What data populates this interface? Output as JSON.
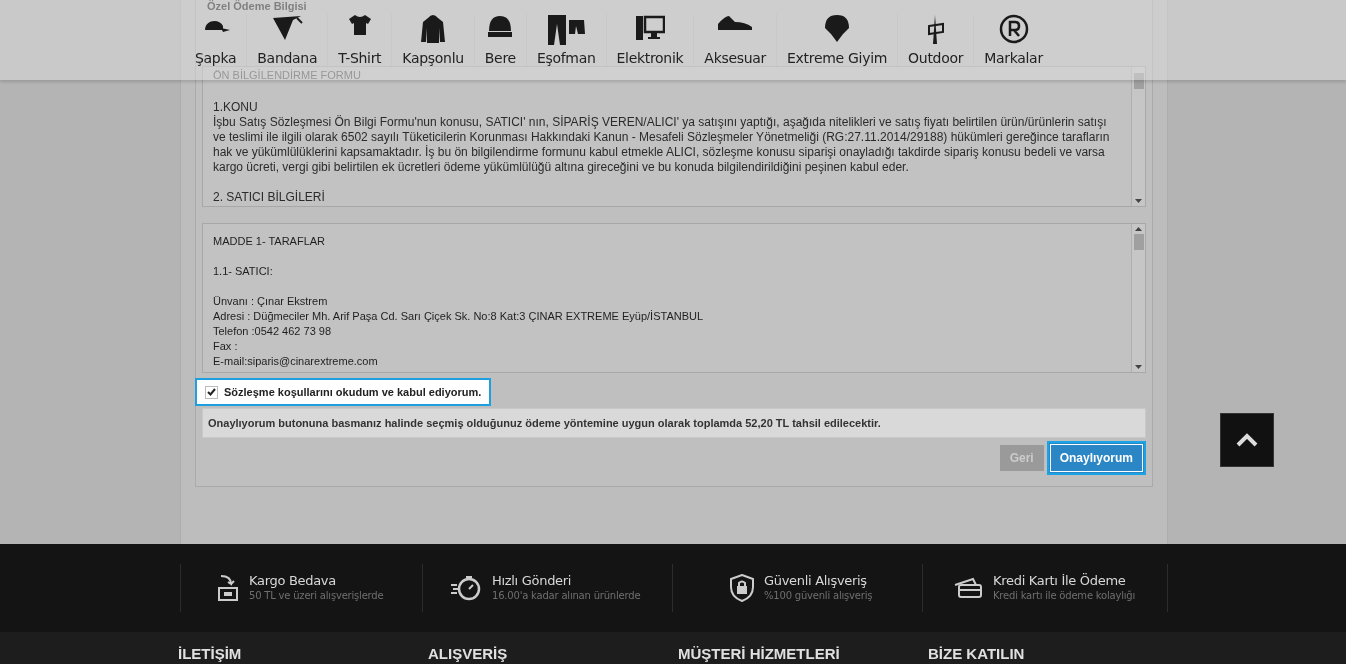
{
  "nav": {
    "items": [
      {
        "label": "Şapka"
      },
      {
        "label": "Bandana"
      },
      {
        "label": "T-Shirt"
      },
      {
        "label": "Kapşonlu"
      },
      {
        "label": "Bere"
      },
      {
        "label": "Eşofman"
      },
      {
        "label": "Elektronik"
      },
      {
        "label": "Aksesuar"
      },
      {
        "label": "Extreme Giyim"
      },
      {
        "label": "Outdoor"
      },
      {
        "label": "Markalar"
      }
    ]
  },
  "payment": {
    "title": "Özel Ödeme Bilgisi"
  },
  "info_form": {
    "title": "ÖN BİLGİLENDİRME FORMU",
    "paragraphs": [
      "1.KONU",
      "İşbu Satış Sözleşmesi Ön Bilgi Formu'nun konusu, SATICI' nın, SİPARİŞ VEREN/ALICI' ya satışını yaptığı, aşağıda nitelikleri ve satış fiyatı belirtilen ürün/ürünlerin satışı ve teslimi ile ilgili olarak 6502 sayılı Tüketicilerin Korunması Hakkındaki Kanun - Mesafeli Sözleşmeler Yönetmeliği (RG:27.11.2014/29188) hükümleri gereğince tarafların hak ve yükümlülüklerini kapsamaktadır. İş bu ön bilgilendirme formunu kabul etmekle ALICI, sözleşme konusu siparişi onayladığı takdirde sipariş konusu bedeli ve varsa kargo ücreti, vergi gibi belirtilen ek ücretleri ödeme yükümlülüğü altına gireceğini ve bu konuda bilgilendirildiğini peşinen kabul eder.",
      "2. SATICI BİLGİLERİ"
    ]
  },
  "contract": {
    "paragraphs": [
      [
        "MADDE 1- TARAFLAR"
      ],
      [
        "1.1- SATICI:"
      ],
      [
        "Ünvanı : Çınar Ekstrem",
        "Adresi : Düğmeciler Mh. Arif Paşa Cd. Sarı Çiçek Sk. No:8 Kat:3 ÇINAR EXTREME Eyüp/İSTANBUL",
        "Telefon :0542 462 73 98",
        "Fax :",
        "E-mail:siparis@cinarextreme.com"
      ]
    ]
  },
  "agreement": {
    "label": "Sözleşme koşullarını okudum ve kabul ediyorum.",
    "checked": true
  },
  "notice": "Onaylıyorum butonuna basmanız halinde seçmiş olduğunuz ödeme yöntemine uygun olarak toplamda 52,20 TL tahsil edilecektir.",
  "buttons": [
    {
      "label": "Geri",
      "kind": "secondary"
    },
    {
      "label": "Onaylıyorum",
      "kind": "primary"
    }
  ],
  "footer": {
    "features": [
      {
        "title": "Kargo Bedava",
        "subtitle": "50 TL ve üzeri alışverişlerde"
      },
      {
        "title": "Hızlı Gönderi",
        "subtitle": "16.00'a kadar alınan ürünlerde"
      },
      {
        "title": "Güvenli Alışveriş",
        "subtitle": "%100 güvenli alışveriş"
      },
      {
        "title": "Kredi Kartı İle Ödeme",
        "subtitle": "Kredi kartı ile ödeme kolaylığı"
      }
    ],
    "columns": [
      "İLETİŞİM",
      "ALIŞVERİŞ",
      "MÜŞTERİ HİZMETLERİ",
      "BİZE KATILIN"
    ]
  }
}
